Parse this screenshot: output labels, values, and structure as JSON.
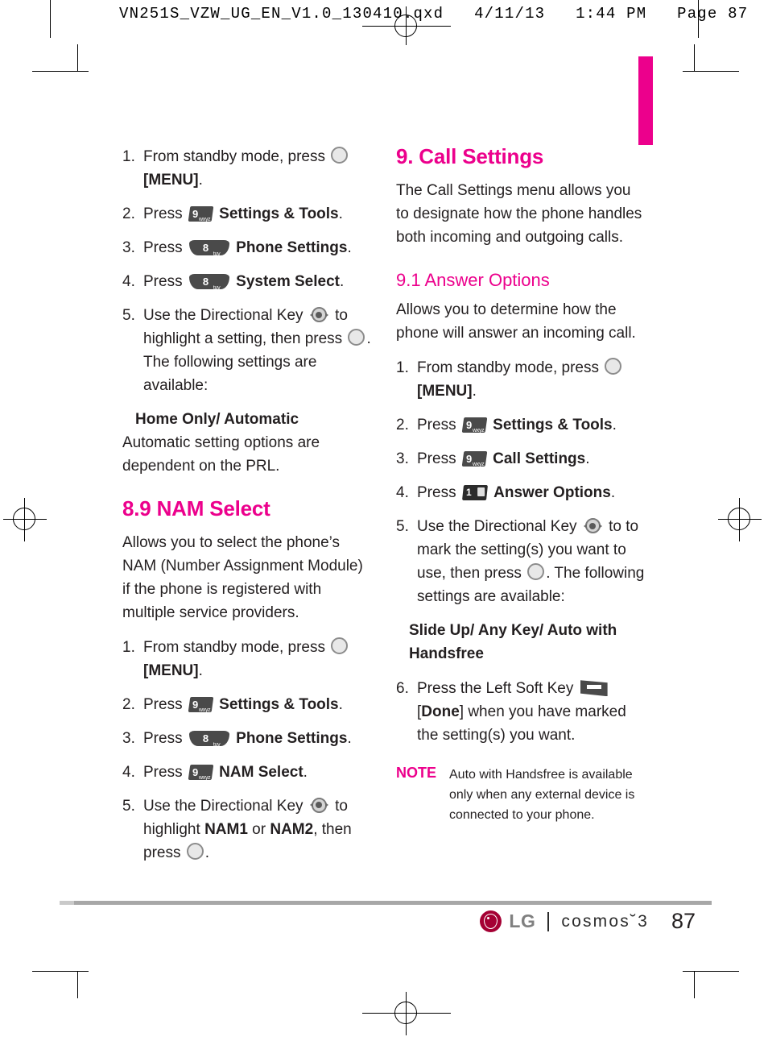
{
  "header": {
    "slug": "VN251S_VZW_UG_EN_V1.0_130410.qxd   4/11/13   1:44 PM   Page 87"
  },
  "colors": {
    "accent_magenta": "#ec008c",
    "lg_crimson": "#a50034",
    "body_text": "#231f20",
    "rule_gray": "#a7a7a7"
  },
  "left_column": {
    "continued_steps": [
      {
        "num": "1.",
        "parts": [
          {
            "t": "text",
            "v": "From standby mode, press "
          },
          {
            "t": "icon",
            "v": "ok-key-icon"
          },
          {
            "t": "text",
            "v": " "
          },
          {
            "t": "bold",
            "v": "[MENU]"
          },
          {
            "t": "text",
            "v": "."
          }
        ]
      },
      {
        "num": "2.",
        "parts": [
          {
            "t": "text",
            "v": "Press "
          },
          {
            "t": "icon",
            "v": "key-9-wxyz-icon"
          },
          {
            "t": "text",
            "v": " "
          },
          {
            "t": "bold",
            "v": "Settings & Tools"
          },
          {
            "t": "text",
            "v": "."
          }
        ]
      },
      {
        "num": "3.",
        "parts": [
          {
            "t": "text",
            "v": "Press "
          },
          {
            "t": "icon",
            "v": "key-8-tuv-icon"
          },
          {
            "t": "text",
            "v": " "
          },
          {
            "t": "bold",
            "v": "Phone Settings"
          },
          {
            "t": "text",
            "v": "."
          }
        ]
      },
      {
        "num": "4.",
        "parts": [
          {
            "t": "text",
            "v": "Press "
          },
          {
            "t": "icon",
            "v": "key-8-tuv-icon"
          },
          {
            "t": "text",
            "v": " "
          },
          {
            "t": "bold",
            "v": "System Select"
          },
          {
            "t": "text",
            "v": "."
          }
        ]
      },
      {
        "num": "5.",
        "parts": [
          {
            "t": "text",
            "v": "Use the Directional Key "
          },
          {
            "t": "icon",
            "v": "directional-key-icon"
          },
          {
            "t": "text",
            "v": " to highlight a setting, then press "
          },
          {
            "t": "icon",
            "v": "ok-key-icon"
          },
          {
            "t": "text",
            "v": ". The following settings are available:"
          }
        ]
      }
    ],
    "option_block": {
      "title": "Home Only/ Automatic",
      "description": "Automatic setting options are dependent on the PRL."
    },
    "section": {
      "heading": "8.9 NAM Select",
      "intro": "Allows you to select the phone’s NAM (Number Assignment Module) if the phone is registered with multiple service providers.",
      "steps": [
        {
          "num": "1.",
          "parts": [
            {
              "t": "text",
              "v": "From standby mode, press "
            },
            {
              "t": "icon",
              "v": "ok-key-icon"
            },
            {
              "t": "text",
              "v": " "
            },
            {
              "t": "bold",
              "v": "[MENU]"
            },
            {
              "t": "text",
              "v": "."
            }
          ]
        },
        {
          "num": "2.",
          "parts": [
            {
              "t": "text",
              "v": "Press "
            },
            {
              "t": "icon",
              "v": "key-9-wxyz-icon"
            },
            {
              "t": "text",
              "v": " "
            },
            {
              "t": "bold",
              "v": "Settings & Tools"
            },
            {
              "t": "text",
              "v": "."
            }
          ]
        },
        {
          "num": "3.",
          "parts": [
            {
              "t": "text",
              "v": "Press "
            },
            {
              "t": "icon",
              "v": "key-8-tuv-icon"
            },
            {
              "t": "text",
              "v": " "
            },
            {
              "t": "bold",
              "v": "Phone Settings"
            },
            {
              "t": "text",
              "v": "."
            }
          ]
        },
        {
          "num": "4.",
          "parts": [
            {
              "t": "text",
              "v": "Press "
            },
            {
              "t": "icon",
              "v": "key-9-wxyz-icon"
            },
            {
              "t": "text",
              "v": " "
            },
            {
              "t": "bold",
              "v": "NAM Select"
            },
            {
              "t": "text",
              "v": "."
            }
          ]
        },
        {
          "num": "5.",
          "parts": [
            {
              "t": "text",
              "v": "Use the Directional Key "
            },
            {
              "t": "icon",
              "v": "directional-key-icon"
            },
            {
              "t": "text",
              "v": " to highlight "
            },
            {
              "t": "bold",
              "v": "NAM1"
            },
            {
              "t": "text",
              "v": " or "
            },
            {
              "t": "bold",
              "v": "NAM2"
            },
            {
              "t": "text",
              "v": ", then press "
            },
            {
              "t": "icon",
              "v": "ok-key-icon"
            },
            {
              "t": "text",
              "v": "."
            }
          ]
        }
      ]
    }
  },
  "right_column": {
    "chapter_heading": "9. Call Settings",
    "chapter_intro": "The Call Settings menu allows you to designate how the phone handles both incoming and outgoing calls.",
    "section": {
      "heading": "9.1 Answer Options",
      "intro": "Allows you to determine how the phone will answer an incoming call.",
      "steps": [
        {
          "num": "1.",
          "parts": [
            {
              "t": "text",
              "v": "From standby mode, press "
            },
            {
              "t": "icon",
              "v": "ok-key-icon"
            },
            {
              "t": "text",
              "v": " "
            },
            {
              "t": "bold",
              "v": "[MENU]"
            },
            {
              "t": "text",
              "v": "."
            }
          ]
        },
        {
          "num": "2.",
          "parts": [
            {
              "t": "text",
              "v": "Press "
            },
            {
              "t": "icon",
              "v": "key-9-wxyz-icon"
            },
            {
              "t": "text",
              "v": " "
            },
            {
              "t": "bold",
              "v": "Settings & Tools"
            },
            {
              "t": "text",
              "v": "."
            }
          ]
        },
        {
          "num": "3.",
          "parts": [
            {
              "t": "text",
              "v": "Press "
            },
            {
              "t": "icon",
              "v": "key-9-wxyz-icon"
            },
            {
              "t": "text",
              "v": " "
            },
            {
              "t": "bold",
              "v": "Call Settings"
            },
            {
              "t": "text",
              "v": "."
            }
          ]
        },
        {
          "num": "4.",
          "parts": [
            {
              "t": "text",
              "v": "Press "
            },
            {
              "t": "icon",
              "v": "key-1-icon"
            },
            {
              "t": "text",
              "v": "  "
            },
            {
              "t": "bold",
              "v": "Answer Options"
            },
            {
              "t": "text",
              "v": "."
            }
          ]
        },
        {
          "num": "5.",
          "parts": [
            {
              "t": "text",
              "v": "Use the Directional Key "
            },
            {
              "t": "icon",
              "v": "directional-key-icon"
            },
            {
              "t": "text",
              "v": " to to mark the setting(s) you want to use, then press "
            },
            {
              "t": "icon",
              "v": "ok-key-icon"
            },
            {
              "t": "text",
              "v": ". The following settings are available:"
            }
          ]
        }
      ],
      "option_block": {
        "title": "Slide Up/ Any Key/ Auto with Handsfree"
      },
      "final_step": {
        "num": "6.",
        "parts": [
          {
            "t": "text",
            "v": "Press the Left Soft Key "
          },
          {
            "t": "icon",
            "v": "left-soft-key-icon"
          },
          {
            "t": "text",
            "v": " ["
          },
          {
            "t": "bold",
            "v": "Done"
          },
          {
            "t": "text",
            "v": "] when you have marked the setting(s) you want."
          }
        ]
      },
      "note": {
        "label": "NOTE",
        "text": "Auto with Handsfree is available only when any external device is connected to your phone."
      }
    }
  },
  "footer": {
    "brand": "LG",
    "product": "cosmos˘3",
    "page_number": "87"
  }
}
